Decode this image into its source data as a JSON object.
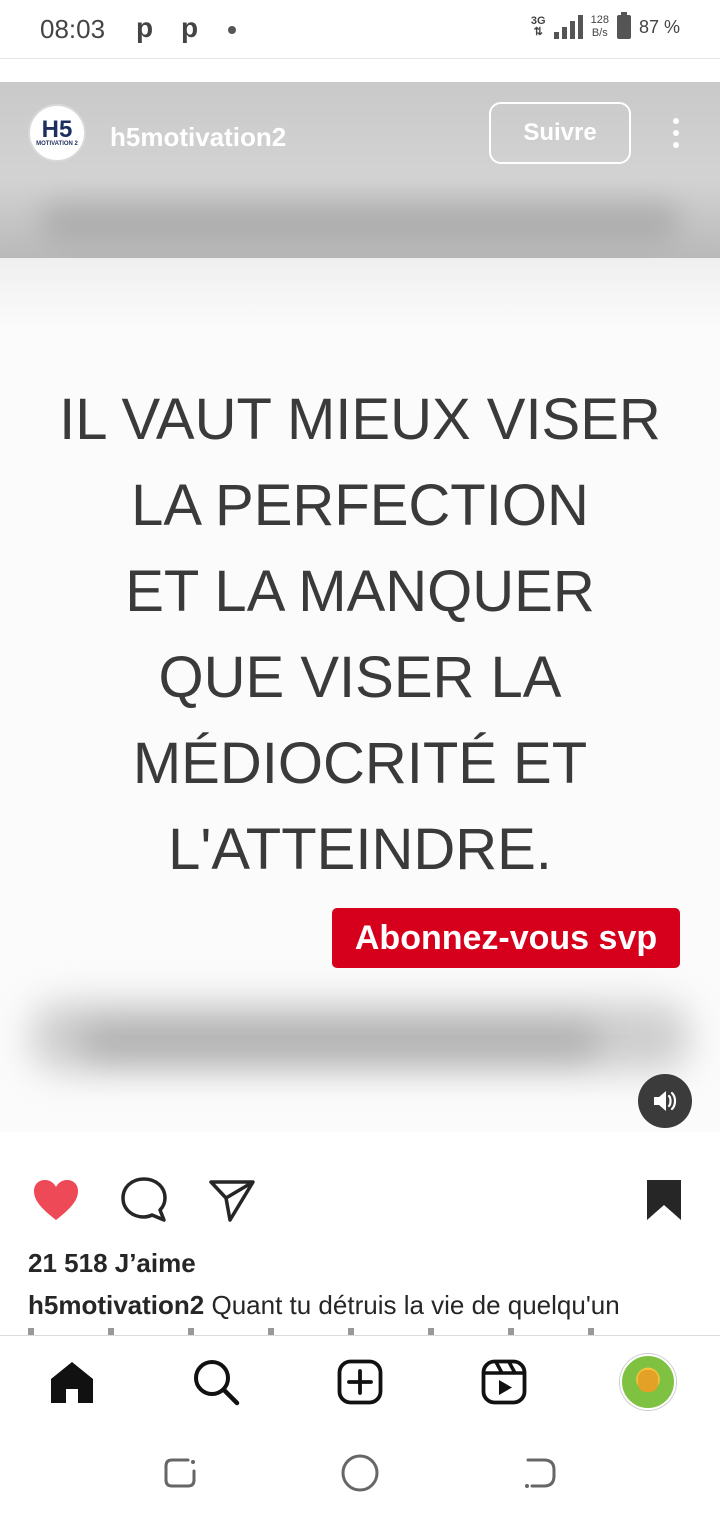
{
  "status_bar": {
    "time": "08:03",
    "notif_icons": [
      "p",
      "p"
    ],
    "network": "3G",
    "rate_value": "128",
    "rate_unit": "B/s",
    "battery": "87 %"
  },
  "post": {
    "author": {
      "username": "h5motivation2",
      "avatar_text": "H5",
      "avatar_sub": "MOTIVATION 2"
    },
    "follow_label": "Suivre",
    "quote_lines": [
      "IL VAUT MIEUX VISER",
      "LA PERFECTION",
      "ET LA MANQUER",
      "QUE VISER LA",
      "MÉDIOCRITÉ ET",
      "L'ATTEINDRE."
    ],
    "subscribe_badge": "Abonnez-vous svp",
    "likes": "21 518 J’aime",
    "caption_user": "h5motivation2",
    "caption_text": " Quant tu détruis la vie de quelqu'un"
  },
  "colors": {
    "like": "#ed4956",
    "badge": "#d6001c",
    "text": "#262626"
  },
  "nav_icons": [
    "home-icon",
    "search-icon",
    "create-icon",
    "reels-icon",
    "profile-avatar"
  ]
}
